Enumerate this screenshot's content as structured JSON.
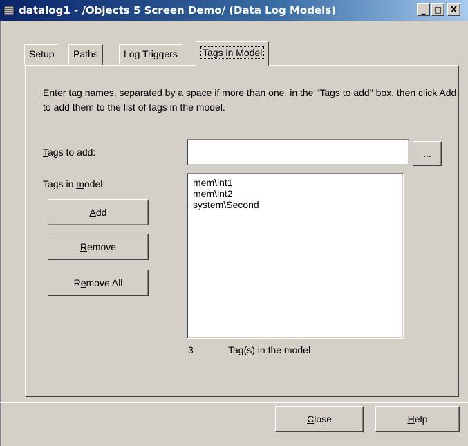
{
  "window": {
    "title": "datalog1 - /Objects 5 Screen Demo/ (Data Log Models)",
    "minimize": "_",
    "maximize": "□",
    "close": "X"
  },
  "tabs": [
    {
      "label": "Setup"
    },
    {
      "label": "Paths"
    },
    {
      "label": "Log Triggers"
    },
    {
      "label": "Tags in Model",
      "active": true
    }
  ],
  "panel": {
    "instructions": "Enter tag names, separated by a space if more than one, in the \"Tags to add\" box, then click Add to add them to the list of tags in the model.",
    "tags_to_add_label_key": "T",
    "tags_to_add_label_rest": "ags to add:",
    "tags_to_add_value": "",
    "browse_label": "...",
    "tags_in_model_label_pre": "Tags in ",
    "tags_in_model_label_key": "m",
    "tags_in_model_label_post": "odel:",
    "tags": [
      "mem\\int1",
      "mem\\int2",
      "system\\Second"
    ],
    "add_key": "A",
    "add_rest": "dd",
    "remove_key": "R",
    "remove_rest": "emove",
    "remove_all_pre": "R",
    "remove_all_key": "e",
    "remove_all_rest": "move All",
    "tag_count": "3",
    "tag_count_label": "Tag(s) in the model"
  },
  "footer": {
    "close_key": "C",
    "close_rest": "lose",
    "help_key": "H",
    "help_rest": "elp"
  }
}
